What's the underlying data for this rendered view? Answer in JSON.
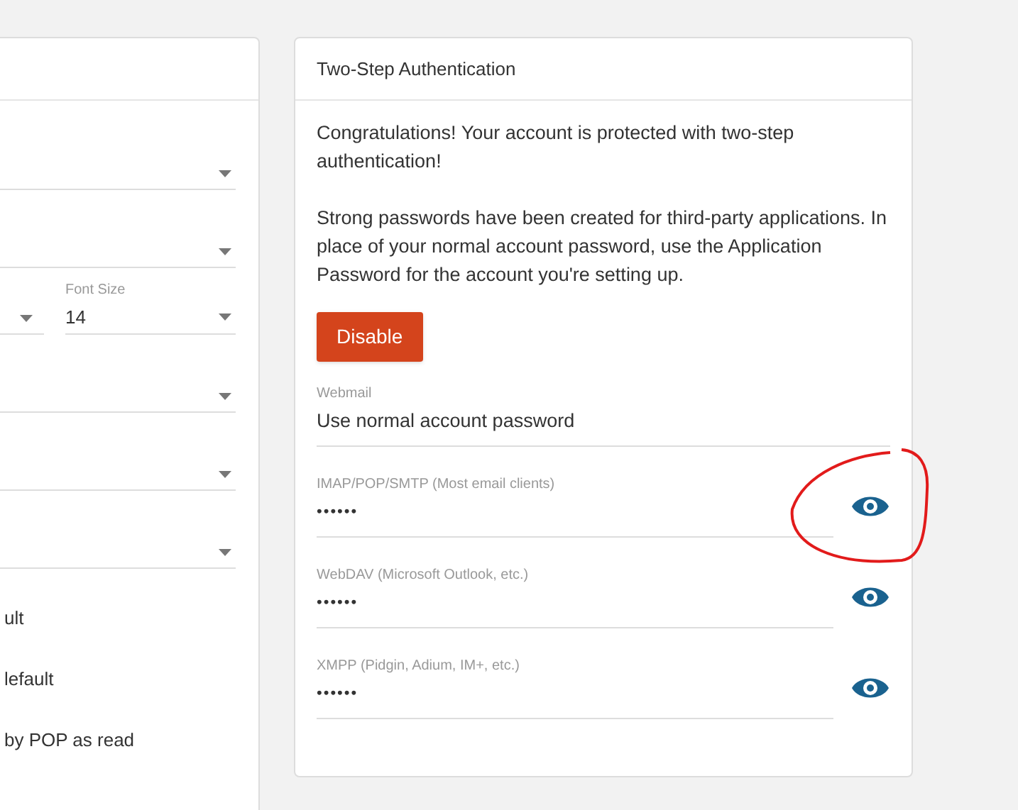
{
  "left_panel": {
    "rows": [
      {
        "kind": "select"
      },
      {
        "kind": "select"
      },
      {
        "kind": "pair",
        "label": "Font Size",
        "value": "14"
      },
      {
        "kind": "select"
      },
      {
        "kind": "select"
      },
      {
        "kind": "select"
      },
      {
        "kind": "text",
        "text": "ult"
      },
      {
        "kind": "text",
        "text": "lefault"
      },
      {
        "kind": "text",
        "text": "by POP as read"
      }
    ]
  },
  "two_step": {
    "title": "Two-Step Authentication",
    "paragraphs": [
      "Congratulations! Your account is protected with two-step authentication!",
      "Strong passwords have been created for third-party applications. In place of your normal account password, use the Application Password for the account you're setting up."
    ],
    "button": "Disable",
    "fields": [
      {
        "kind": "text",
        "label": "Webmail",
        "value": "Use normal account password",
        "circled": false
      },
      {
        "kind": "password",
        "label": "IMAP/POP/SMTP (Most email clients)",
        "value": "••••••",
        "circled": true
      },
      {
        "kind": "password",
        "label": "WebDAV (Microsoft Outlook, etc.)",
        "value": "••••••",
        "circled": false
      },
      {
        "kind": "password",
        "label": "XMPP (Pidgin, Adium, IM+, etc.)",
        "value": "••••••",
        "circled": false
      }
    ]
  }
}
